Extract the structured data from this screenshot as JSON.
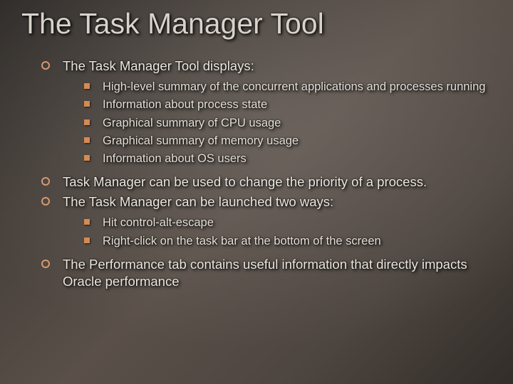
{
  "title": "The Task Manager Tool",
  "items": [
    {
      "text": "The Task Manager Tool displays:",
      "sub": [
        "High-level summary of the concurrent applications and processes running",
        "Information about process state",
        "Graphical summary of CPU usage",
        "Graphical summary of memory usage",
        "Information about OS users"
      ]
    },
    {
      "text": "Task Manager can be used to change the priority of a process."
    },
    {
      "text": "The Task Manager can be launched two ways:",
      "sub": [
        "Hit control-alt-escape",
        "Right-click on the task bar at the bottom of the screen"
      ]
    },
    {
      "text": "The Performance tab contains useful information that directly impacts Oracle performance"
    }
  ]
}
